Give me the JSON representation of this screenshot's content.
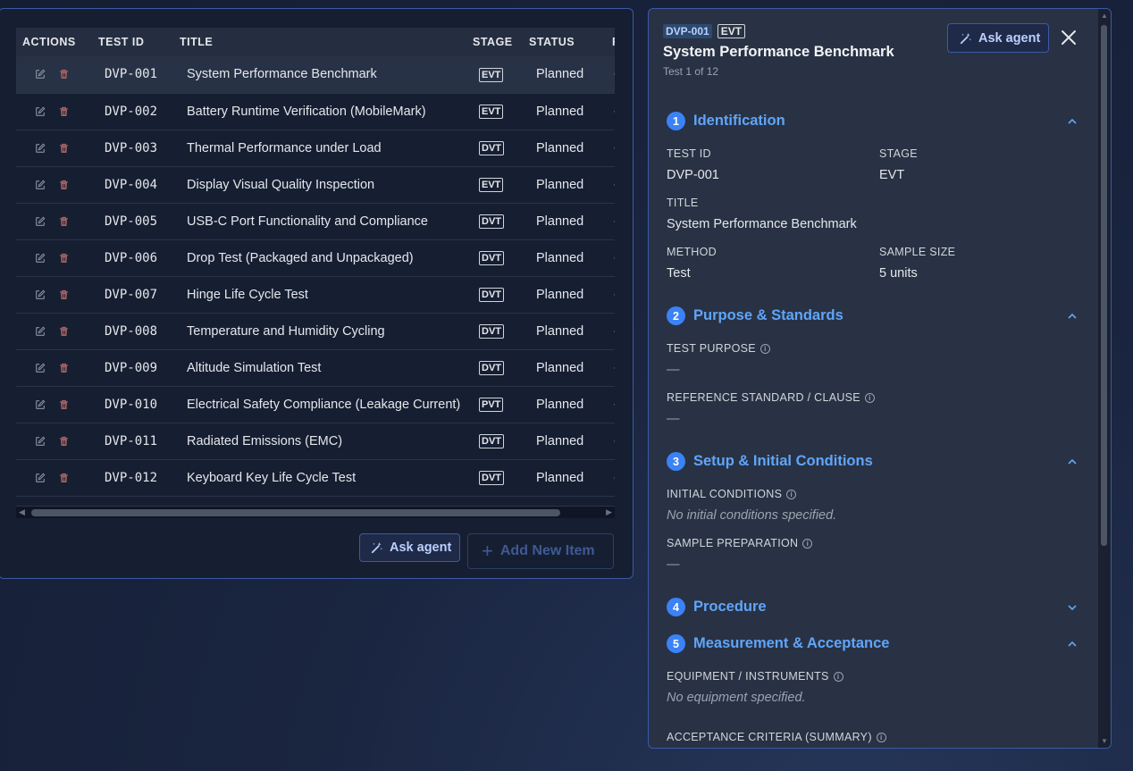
{
  "table": {
    "headers": {
      "actions": "ACTIONS",
      "test_id": "TEST ID",
      "title": "TITLE",
      "stage": "STAGE",
      "status": "STATUS",
      "req": "RI"
    },
    "rows": [
      {
        "id": "DVP-001",
        "title": "System Performance Benchmark",
        "stage": "EVT",
        "status": "Planned",
        "req": "-"
      },
      {
        "id": "DVP-002",
        "title": "Battery Runtime Verification (MobileMark)",
        "stage": "EVT",
        "status": "Planned",
        "req": "-"
      },
      {
        "id": "DVP-003",
        "title": "Thermal Performance under Load",
        "stage": "DVT",
        "status": "Planned",
        "req": "-"
      },
      {
        "id": "DVP-004",
        "title": "Display Visual Quality Inspection",
        "stage": "EVT",
        "status": "Planned",
        "req": "-"
      },
      {
        "id": "DVP-005",
        "title": "USB-C Port Functionality and Compliance",
        "stage": "DVT",
        "status": "Planned",
        "req": "-"
      },
      {
        "id": "DVP-006",
        "title": "Drop Test (Packaged and Unpackaged)",
        "stage": "DVT",
        "status": "Planned",
        "req": "-"
      },
      {
        "id": "DVP-007",
        "title": "Hinge Life Cycle Test",
        "stage": "DVT",
        "status": "Planned",
        "req": "-"
      },
      {
        "id": "DVP-008",
        "title": "Temperature and Humidity Cycling",
        "stage": "DVT",
        "status": "Planned",
        "req": "-"
      },
      {
        "id": "DVP-009",
        "title": "Altitude Simulation Test",
        "stage": "DVT",
        "status": "Planned",
        "req": "-"
      },
      {
        "id": "DVP-010",
        "title": "Electrical Safety Compliance (Leakage Current)",
        "stage": "PVT",
        "status": "Planned",
        "req": "-"
      },
      {
        "id": "DVP-011",
        "title": "Radiated Emissions (EMC)",
        "stage": "DVT",
        "status": "Planned",
        "req": "-"
      },
      {
        "id": "DVP-012",
        "title": "Keyboard Key Life Cycle Test",
        "stage": "DVT",
        "status": "Planned",
        "req": "-"
      }
    ],
    "ask_agent_label": "Ask agent",
    "add_item_label": "Add New Item"
  },
  "detail": {
    "id_badge": "DVP-001",
    "stage_badge": "EVT",
    "title": "System Performance Benchmark",
    "subtitle": "Test 1 of 12",
    "ask_agent_label": "Ask agent",
    "sections": {
      "s1": {
        "num": "1",
        "title": "Identification"
      },
      "s2": {
        "num": "2",
        "title": "Purpose & Standards"
      },
      "s3": {
        "num": "3",
        "title": "Setup & Initial Conditions"
      },
      "s4": {
        "num": "4",
        "title": "Procedure"
      },
      "s5": {
        "num": "5",
        "title": "Measurement & Acceptance"
      }
    },
    "fields": {
      "test_id_label": "TEST ID",
      "test_id_value": "DVP-001",
      "stage_label": "STAGE",
      "stage_value": "EVT",
      "title_label": "TITLE",
      "title_value": "System Performance Benchmark",
      "method_label": "METHOD",
      "method_value": "Test",
      "sample_size_label": "SAMPLE SIZE",
      "sample_size_value": "5 units",
      "purpose_label": "TEST PURPOSE",
      "purpose_value": "—",
      "reference_label": "REFERENCE STANDARD / CLAUSE",
      "reference_value": "—",
      "initial_label": "INITIAL CONDITIONS",
      "initial_value": "No initial conditions specified.",
      "prep_label": "SAMPLE PREPARATION",
      "prep_value": "—",
      "equipment_label": "EQUIPMENT / INSTRUMENTS",
      "equipment_value": "No equipment specified.",
      "acceptance_label": "ACCEPTANCE CRITERIA (SUMMARY)"
    }
  },
  "colors": {
    "accent": "#3b82f6",
    "heading": "#60a5fa",
    "panel": "#283244",
    "border": "#3b5aa6"
  }
}
